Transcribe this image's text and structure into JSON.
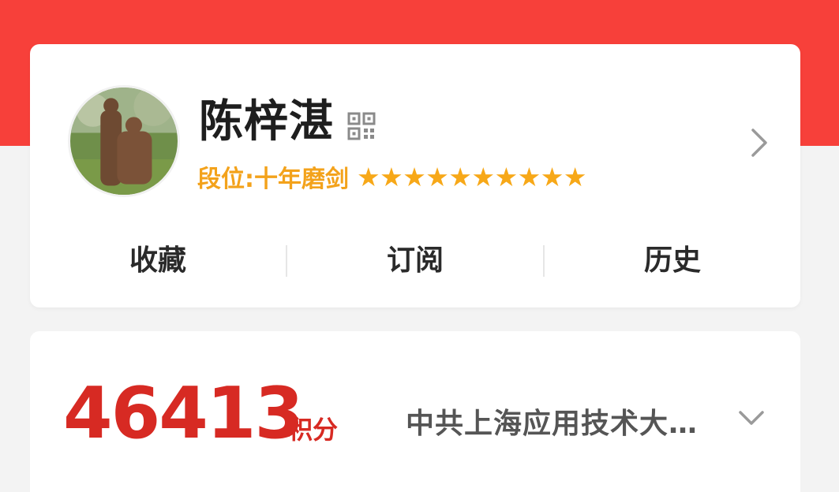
{
  "profile": {
    "username": "陈梓湛",
    "rank_label": "段位:十年磨剑",
    "stars": [
      "★",
      "★",
      "★",
      "★",
      "★",
      "★",
      "★",
      "★",
      "★",
      "★"
    ],
    "icons": {
      "qr": "qr-code-icon",
      "chevron": "chevron-right-icon"
    },
    "accent_color": "#f3a21b"
  },
  "tabs": [
    {
      "label": "收藏"
    },
    {
      "label": "订阅"
    },
    {
      "label": "历史"
    }
  ],
  "points": {
    "value": "46413",
    "unit": "积分",
    "organization": "中共上海应用技术大…",
    "dropdown_icon": "chevron-down-icon",
    "color": "#d72a23"
  },
  "theme": {
    "header_color": "#f7403a"
  }
}
